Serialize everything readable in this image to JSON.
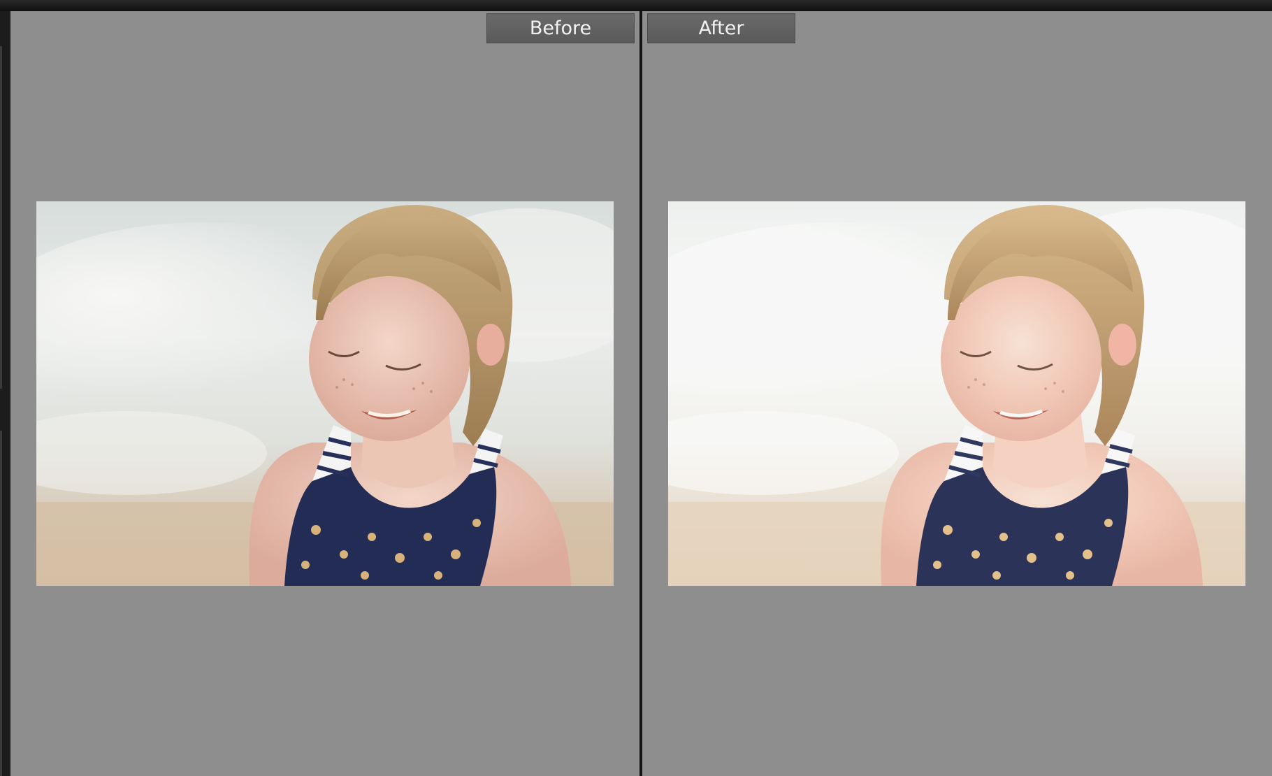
{
  "compare_view": {
    "before": {
      "label": "Before",
      "image": "beach-portrait-original"
    },
    "after": {
      "label": "After",
      "image": "beach-portrait-edited"
    }
  },
  "colors": {
    "background": "#8e8e8e",
    "label_bg": "#5f5f5f",
    "label_text": "#f2f2f2",
    "divider": "#141414"
  }
}
